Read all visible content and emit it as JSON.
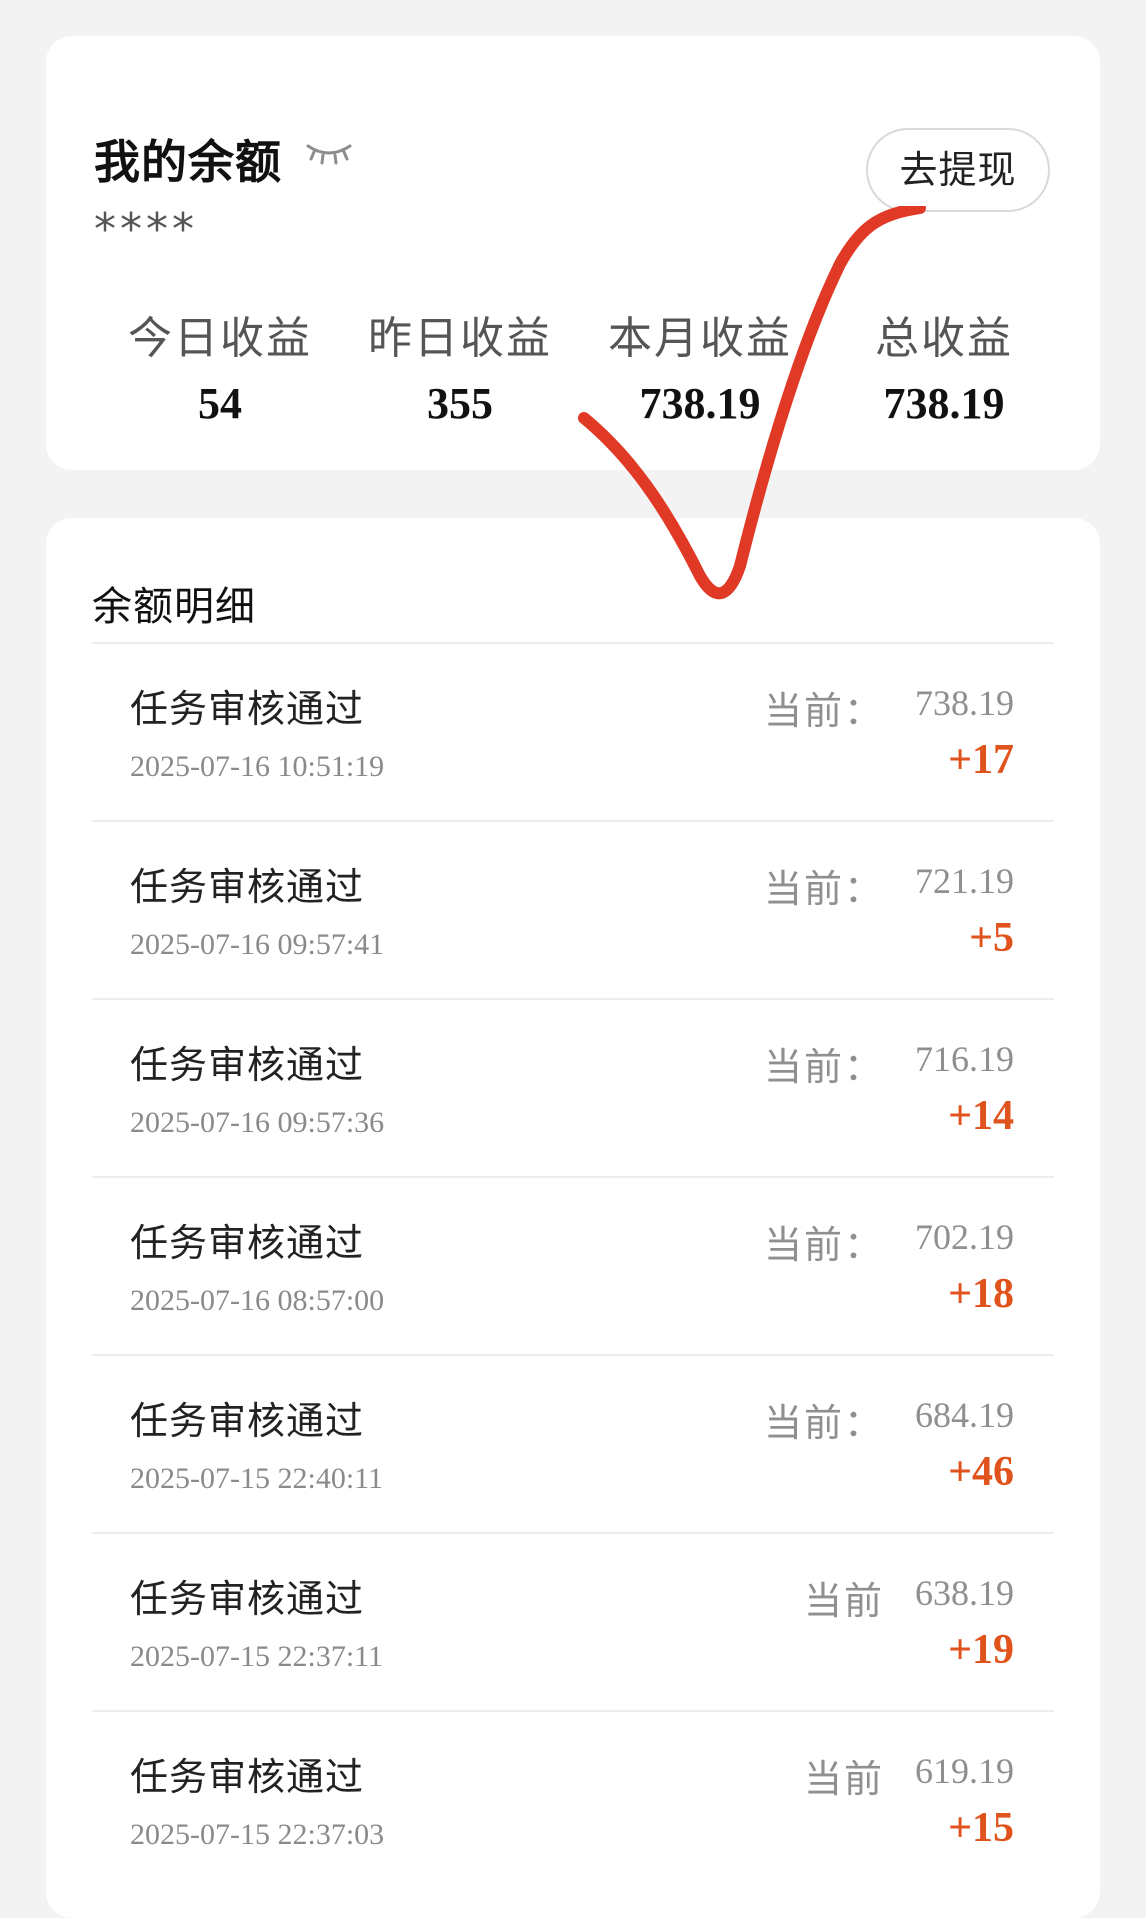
{
  "balance": {
    "title": "我的余额",
    "masked_value": "****",
    "withdraw_label": "去提现",
    "stats": [
      {
        "label": "今日收益",
        "value": "54"
      },
      {
        "label": "昨日收益",
        "value": "355"
      },
      {
        "label": "本月收益",
        "value": "738.19"
      },
      {
        "label": "总收益",
        "value": "738.19"
      }
    ]
  },
  "details": {
    "title": "余额明细",
    "items": [
      {
        "title": "任务审核通过",
        "time": "2025-07-16 10:51:19",
        "current_label": "当前：",
        "current_value": "738.19",
        "amount": "+17"
      },
      {
        "title": "任务审核通过",
        "time": "2025-07-16 09:57:41",
        "current_label": "当前：",
        "current_value": "721.19",
        "amount": "+5"
      },
      {
        "title": "任务审核通过",
        "time": "2025-07-16 09:57:36",
        "current_label": "当前：",
        "current_value": "716.19",
        "amount": "+14"
      },
      {
        "title": "任务审核通过",
        "time": "2025-07-16 08:57:00",
        "current_label": "当前：",
        "current_value": "702.19",
        "amount": "+18"
      },
      {
        "title": "任务审核通过",
        "time": "2025-07-15 22:40:11",
        "current_label": "当前：",
        "current_value": "684.19",
        "amount": "+46"
      },
      {
        "title": "任务审核通过",
        "time": "2025-07-15 22:37:11",
        "current_label": "当前",
        "current_value": "638.19",
        "amount": "+19"
      },
      {
        "title": "任务审核通过",
        "time": "2025-07-15 22:37:03",
        "current_label": "当前",
        "current_value": "619.19",
        "amount": "+15"
      }
    ]
  },
  "colors": {
    "accent": "#e0531d",
    "checkmark": "#e03a26"
  },
  "icons": {
    "hide_balance": "closed-eye-icon"
  }
}
